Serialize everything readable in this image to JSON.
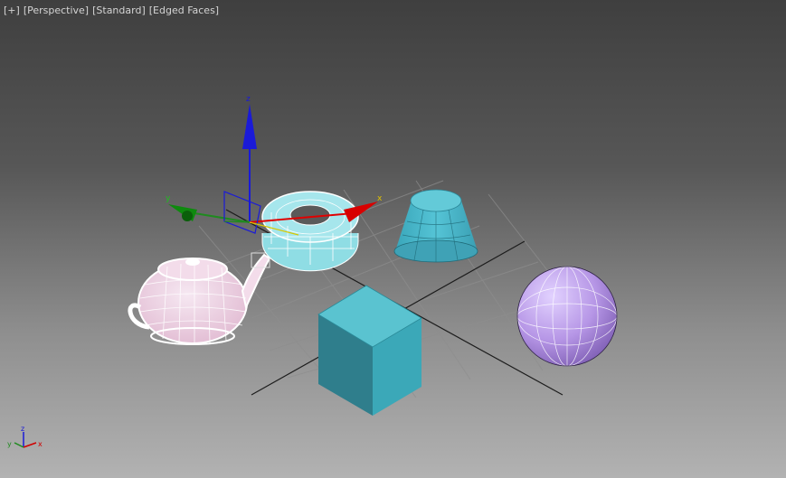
{
  "viewport": {
    "labels": [
      {
        "id": "plus-menu",
        "text": "[+]"
      },
      {
        "id": "view-menu",
        "text": "[Perspective]"
      },
      {
        "id": "shading-menu",
        "text": "[Standard]"
      },
      {
        "id": "display-mode-menu",
        "text": "[Edged Faces]"
      }
    ]
  },
  "gizmo": {
    "x_label": "x",
    "y_label": "y",
    "z_label": "z",
    "x_color": "#e00000",
    "y_color": "#1f8a1f",
    "z_color": "#1a1ad8"
  },
  "view_cube_triad": {
    "x_label": "x",
    "y_label": "y",
    "z_label": "z"
  },
  "objects": [
    {
      "name": "Teapot",
      "color": "#ffffff",
      "display": "wireframe-pink"
    },
    {
      "name": "Torus",
      "color": "#7fd6de",
      "selected": true
    },
    {
      "name": "Cone",
      "color": "#46b4c8"
    },
    {
      "name": "Box",
      "color": "#4bb6c6"
    },
    {
      "name": "Sphere",
      "color": "#b696e6"
    }
  ]
}
